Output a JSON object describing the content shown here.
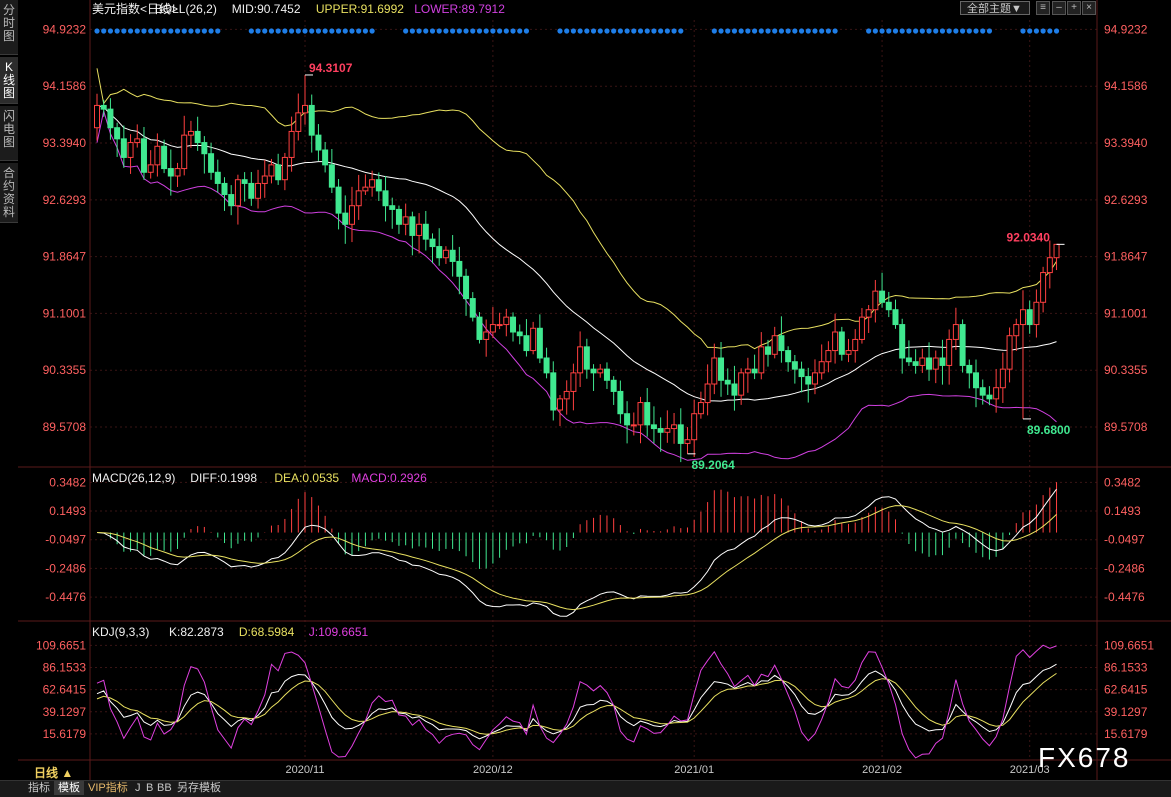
{
  "ui": {
    "side_tabs": [
      "分时图",
      "K线图",
      "闪电图",
      "合约资料"
    ],
    "active_side_tab": 1,
    "theme_select": "全部主题▼",
    "period_label": "日线 ▲",
    "bottom_tabs": [
      "指标",
      "模板",
      "VIP指标",
      "J",
      "B",
      "BB",
      "另存模板"
    ],
    "active_bottom_tab": 1,
    "watermark": "FX678"
  },
  "colors": {
    "up": "#ff4040",
    "down": "#40e890",
    "upper": "#e8e060",
    "mid": "#ffffff",
    "lower": "#d040e0",
    "dif": "#ffffff",
    "dea": "#e8e060",
    "k": "#ffffff",
    "d": "#e8e060",
    "j": "#e040e0",
    "axis_label": "#ff6060",
    "grid": "#3a1414",
    "dots": "#1e7ee8"
  },
  "chart_data": [
    {
      "type": "candlestick",
      "title": "美元指数<日线>",
      "indicator": "BOLL(26,2)",
      "legend": {
        "mid": "MID:90.7452",
        "upper": "UPPER:91.6992",
        "lower": "LOWER:89.7912"
      },
      "y_ticks": [
        "94.9232",
        "94.1586",
        "93.3940",
        "92.6293",
        "91.8647",
        "91.1001",
        "90.3355",
        "89.5708"
      ],
      "ylim": [
        89.1,
        95.05
      ],
      "x_ticks": [
        {
          "index": 31,
          "label": "2020/11"
        },
        {
          "index": 59,
          "label": "2020/12"
        },
        {
          "index": 89,
          "label": "2021/01"
        },
        {
          "index": 117,
          "label": "2021/02"
        },
        {
          "index": 139,
          "label": "2021/03"
        }
      ],
      "annotations": [
        {
          "index": 31,
          "value": 94.31,
          "label": "94.3107",
          "kind": "high"
        },
        {
          "index": 88,
          "value": 89.21,
          "label": "89.2064",
          "kind": "low"
        },
        {
          "index": 138,
          "value": 89.68,
          "label": "89.6800",
          "kind": "low"
        },
        {
          "index": 143,
          "value": 92.03,
          "label": "92.0340",
          "kind": "high"
        }
      ],
      "open_start": 93.6,
      "closes": [
        93.9,
        93.85,
        93.6,
        93.45,
        93.2,
        93.4,
        93.45,
        93.0,
        93.1,
        93.35,
        93.05,
        92.95,
        93.05,
        93.5,
        93.55,
        93.4,
        93.25,
        93.0,
        92.85,
        92.7,
        92.55,
        92.9,
        92.85,
        92.65,
        92.85,
        92.95,
        93.1,
        92.9,
        93.2,
        93.55,
        93.8,
        93.9,
        93.5,
        93.3,
        93.1,
        92.8,
        92.45,
        92.3,
        92.55,
        92.75,
        92.8,
        92.9,
        92.75,
        92.55,
        92.5,
        92.3,
        92.4,
        92.15,
        92.3,
        92.1,
        92.0,
        91.85,
        91.95,
        91.8,
        91.6,
        91.3,
        91.05,
        90.75,
        90.85,
        90.95,
        90.95,
        91.05,
        90.85,
        90.8,
        90.6,
        90.9,
        90.5,
        90.3,
        89.8,
        89.95,
        90.05,
        90.3,
        90.65,
        90.35,
        90.3,
        90.35,
        90.2,
        90.05,
        89.75,
        89.6,
        89.6,
        89.9,
        89.6,
        89.55,
        89.5,
        89.55,
        89.6,
        89.35,
        89.4,
        89.75,
        89.9,
        90.15,
        90.5,
        90.2,
        90.15,
        90.0,
        90.3,
        90.35,
        90.3,
        90.65,
        90.55,
        90.8,
        90.6,
        90.45,
        90.35,
        90.25,
        90.15,
        90.3,
        90.45,
        90.6,
        90.85,
        90.55,
        90.6,
        90.75,
        91.05,
        91.15,
        91.4,
        91.25,
        91.15,
        90.95,
        90.5,
        90.45,
        90.4,
        90.5,
        90.35,
        90.5,
        90.4,
        90.75,
        90.95,
        90.4,
        90.3,
        90.1,
        90.0,
        89.95,
        90.1,
        90.35,
        90.8,
        90.95,
        91.15,
        90.95,
        91.25,
        91.65,
        91.85,
        92.03
      ],
      "series_legend": [
        "MID",
        "UPPER",
        "LOWER"
      ]
    },
    {
      "type": "bar+line",
      "indicator": "MACD(26,12,9)",
      "legend": {
        "diff": "DIFF:0.1998",
        "dea": "DEA:0.0535",
        "macd": "MACD:0.2926"
      },
      "y_ticks": [
        "0.3482",
        "0.1493",
        "-0.0497",
        "-0.2486",
        "-0.4476"
      ],
      "ylim": [
        -0.5858,
        0.3992
      ]
    },
    {
      "type": "line",
      "indicator": "KDJ(9,3,3)",
      "legend": {
        "k": "K:82.2873",
        "d": "D:68.5984",
        "j": "J:109.6651"
      },
      "y_ticks": [
        "109.6651",
        "86.1533",
        "62.6415",
        "39.1297",
        "15.6179"
      ],
      "ylim": [
        -10,
        126
      ]
    }
  ]
}
